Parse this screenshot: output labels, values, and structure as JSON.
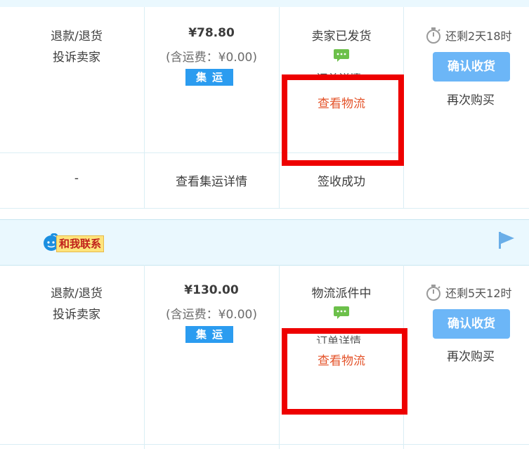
{
  "orders": [
    {
      "refund_label": "退款/退货",
      "complain_label": "投诉卖家",
      "price": "¥78.80",
      "shipping_note": "(含运费：¥0.00)",
      "consolidation_tag": "集运",
      "status": "卖家已发货",
      "order_detail_label": "订单详情",
      "view_logistics_label": "查看物流",
      "remaining_time": "还剩2天18时",
      "confirm_button": "确认收货",
      "buy_again_label": "再次购买",
      "sub_row": {
        "refund_value": "-",
        "consolidation_detail": "查看集运详情",
        "sign_status": "签收成功"
      }
    },
    {
      "refund_label": "退款/退货",
      "complain_label": "投诉卖家",
      "price": "¥130.00",
      "shipping_note": "(含运费：¥0.00)",
      "consolidation_tag": "集运",
      "status": "物流派件中",
      "order_detail_label": "订单详情",
      "view_logistics_label": "查看物流",
      "remaining_time": "还剩5天12时",
      "confirm_button": "确认收货",
      "buy_again_label": "再次购买"
    }
  ],
  "shop_header": {
    "contact_label": "和我联系"
  },
  "icons": {
    "chat": "chat-bubble-icon",
    "timer": "stopwatch-icon",
    "flag": "flag-icon",
    "contact": "aliwangwang-icon"
  },
  "colors": {
    "header_bg": "#eaf8fe",
    "confirm_button_bg": "#6cb6f7",
    "tag_bg": "#2b9cf0",
    "link_orange": "#e4532a",
    "chat_green": "#6cc04a",
    "highlight_red": "#ee0000"
  }
}
